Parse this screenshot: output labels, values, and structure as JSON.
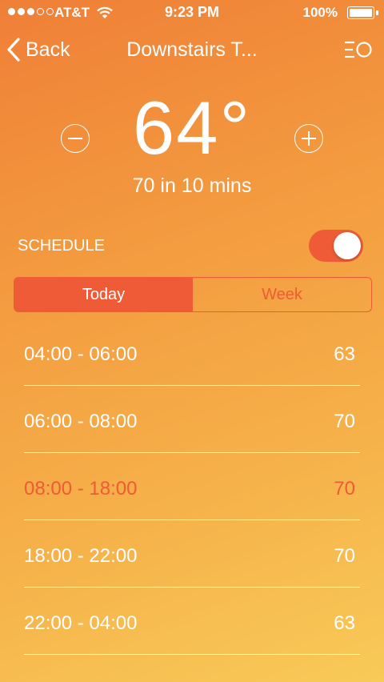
{
  "status_bar": {
    "carrier": "AT&T",
    "time": "9:23 PM",
    "battery": "100%",
    "signal_strength": 3
  },
  "nav": {
    "back_label": "Back",
    "title": "Downstairs T..."
  },
  "temperature": {
    "value": "64°",
    "minus_icon": "minus-circle-icon",
    "plus_icon": "plus-circle-icon"
  },
  "sub_status": "70 in 10 mins",
  "schedule": {
    "label": "SCHEDULE",
    "enabled": true
  },
  "tabs": [
    {
      "label": "Today",
      "active": true
    },
    {
      "label": "Week",
      "active": false
    }
  ],
  "entries": [
    {
      "range": "04:00 - 06:00",
      "value": "63"
    },
    {
      "range": "06:00 - 08:00",
      "value": "70"
    },
    {
      "range": "08:00 - 18:00",
      "value": "70",
      "current": true
    },
    {
      "range": "18:00 - 22:00",
      "value": "70"
    },
    {
      "range": "22:00 - 04:00",
      "value": "63"
    }
  ],
  "colors": {
    "accent": "#ee5b36",
    "gradient_top": "#ef7f37",
    "gradient_bottom": "#f8ca58"
  }
}
